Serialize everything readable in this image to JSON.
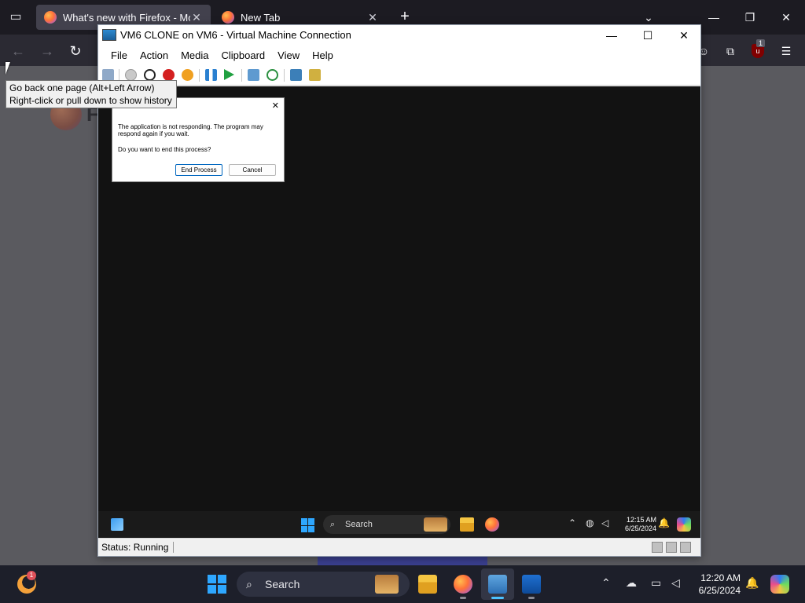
{
  "browser": {
    "tabs": [
      {
        "title": "What's new with Firefox - More",
        "active": true
      },
      {
        "title": "New Tab",
        "active": false
      }
    ],
    "tooltip": {
      "line1": "Go back one page (Alt+Left Arrow)",
      "line2": "Right-click or pull down to show history"
    },
    "logo_letter": "F",
    "extension_badge": "1"
  },
  "vm": {
    "title": "VM6 CLONE on VM6 - Virtual Machine Connection",
    "menu": [
      "File",
      "Action",
      "Media",
      "Clipboard",
      "View",
      "Help"
    ],
    "status": "Status: Running",
    "dialog": {
      "message": "The application is not responding. The program may respond again if you wait.",
      "question": "Do you want to end this process?",
      "end_label": "End Process",
      "cancel_label": "Cancel"
    },
    "taskbar": {
      "search": "Search",
      "time": "12:15 AM",
      "date": "6/25/2024"
    }
  },
  "host_taskbar": {
    "weather_badge": "1",
    "search": "Search",
    "time": "12:20 AM",
    "date": "6/25/2024"
  }
}
